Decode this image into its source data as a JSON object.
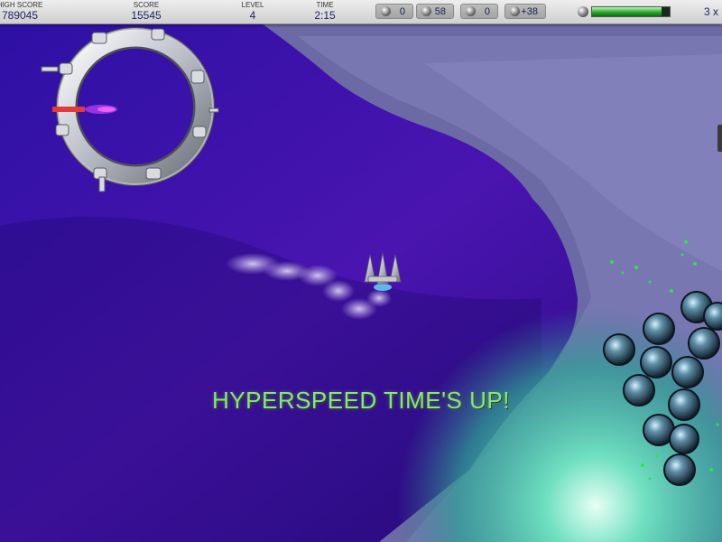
{
  "hud": {
    "high_score_label": "HIGH SCORE",
    "high_score": "789045",
    "score_label": "SCORE",
    "score": "15545",
    "level_label": "LEVEL",
    "level": "4",
    "time_label": "TIME",
    "time": "2:15",
    "inventory": [
      {
        "icon": "missile-icon",
        "value": "0"
      },
      {
        "icon": "crystal-icon",
        "value": "58"
      },
      {
        "icon": "bomb-icon",
        "value": "0"
      },
      {
        "icon": "bonus-icon",
        "value": "+38"
      }
    ],
    "shield_icon": "ship-shield-icon",
    "shield_level": 0.9,
    "lives": "3 x"
  },
  "message": "HYPERSPEED TIME'S UP!",
  "colors": {
    "hud_text": "#1c2560",
    "message": "#8ee37a",
    "energy": "#2ea62e"
  }
}
